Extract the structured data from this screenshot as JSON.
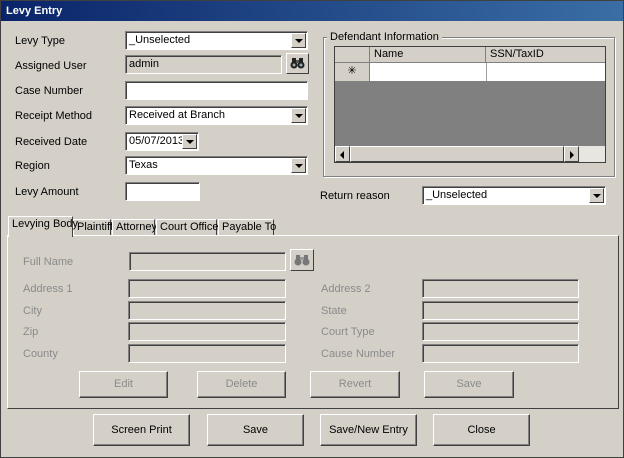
{
  "window": {
    "title": "Levy Entry"
  },
  "form": {
    "levy_type": {
      "label": "Levy Type",
      "value": "_Unselected"
    },
    "assigned_user": {
      "label": "Assigned User",
      "value": "admin"
    },
    "case_number": {
      "label": "Case Number",
      "value": ""
    },
    "receipt_method": {
      "label": "Receipt Method",
      "value": "Received at Branch"
    },
    "received_date": {
      "label": "Received Date",
      "value": "05/07/2013"
    },
    "region": {
      "label": "Region",
      "value": "Texas"
    },
    "levy_amount": {
      "label": "Levy Amount",
      "value": ""
    }
  },
  "defendant": {
    "title": "Defendant Information",
    "columns": [
      "Name",
      "SSN/TaxID"
    ],
    "new_row_marker": "✳"
  },
  "return_reason": {
    "label": "Return reason",
    "value": "_Unselected"
  },
  "tabs": [
    "Levying Body",
    "Plaintiff",
    "Attorney",
    "Court Officer",
    "Payable To"
  ],
  "levying_body": {
    "full_name": "Full Name",
    "address1": "Address 1",
    "address2": "Address 2",
    "city": "City",
    "state": "State",
    "zip": "Zip",
    "court_type": "Court Type",
    "county": "County",
    "cause_number": "Cause Number",
    "buttons": {
      "edit": "Edit",
      "delete": "Delete",
      "revert": "Revert",
      "save": "Save"
    }
  },
  "footer": {
    "screen_print": "Screen Print",
    "save": "Save",
    "save_new": "Save/New Entry",
    "close": "Close"
  },
  "icons": {
    "lookup": "binoculars-icon"
  }
}
